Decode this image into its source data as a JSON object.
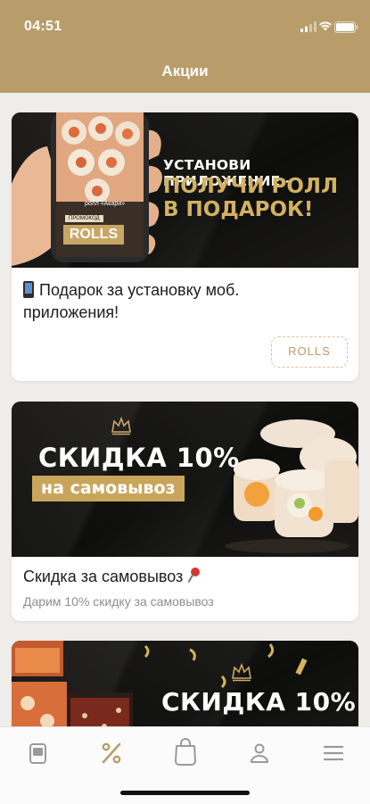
{
  "status_bar": {
    "time": "04:51"
  },
  "header": {
    "title": "Акции"
  },
  "promos": [
    {
      "banner": {
        "headline_line1": "УСТАНОВИ ПРИЛОЖЕНИЕ -",
        "headline_line2": "ПОЛУЧИ РОЛЛ",
        "headline_line3": "В ПОДАРОК!",
        "phone_caption": "ролл «Акари»",
        "promo_small_label": "ПРОМОКОД",
        "promo_code": "ROLLS"
      },
      "icon": "mobile-phone-emoji-icon",
      "title_line1": "Подарок за установку моб.",
      "title_line2": "приложения!",
      "code_button": "ROLLS"
    },
    {
      "banner": {
        "headline": "СКИДКА 10%",
        "subline": "на самовывоз"
      },
      "title": "Скидка за самовывоз",
      "icon": "pushpin-emoji-icon",
      "description": "Дарим 10% скидку за самовывоз"
    },
    {
      "banner": {
        "headline": "СКИДКА 10%"
      }
    }
  ],
  "tabbar": {
    "items": [
      {
        "icon": "menu-book-icon",
        "active": false
      },
      {
        "icon": "percent-icon",
        "active": true
      },
      {
        "icon": "shopping-bag-icon",
        "active": false
      },
      {
        "icon": "profile-icon",
        "active": false
      },
      {
        "icon": "hamburger-menu-icon",
        "active": false
      }
    ]
  },
  "colors": {
    "accent": "#b89d6a",
    "gold_text": "#d2b163",
    "background": "#efedea",
    "banner_dark": "#161513"
  }
}
